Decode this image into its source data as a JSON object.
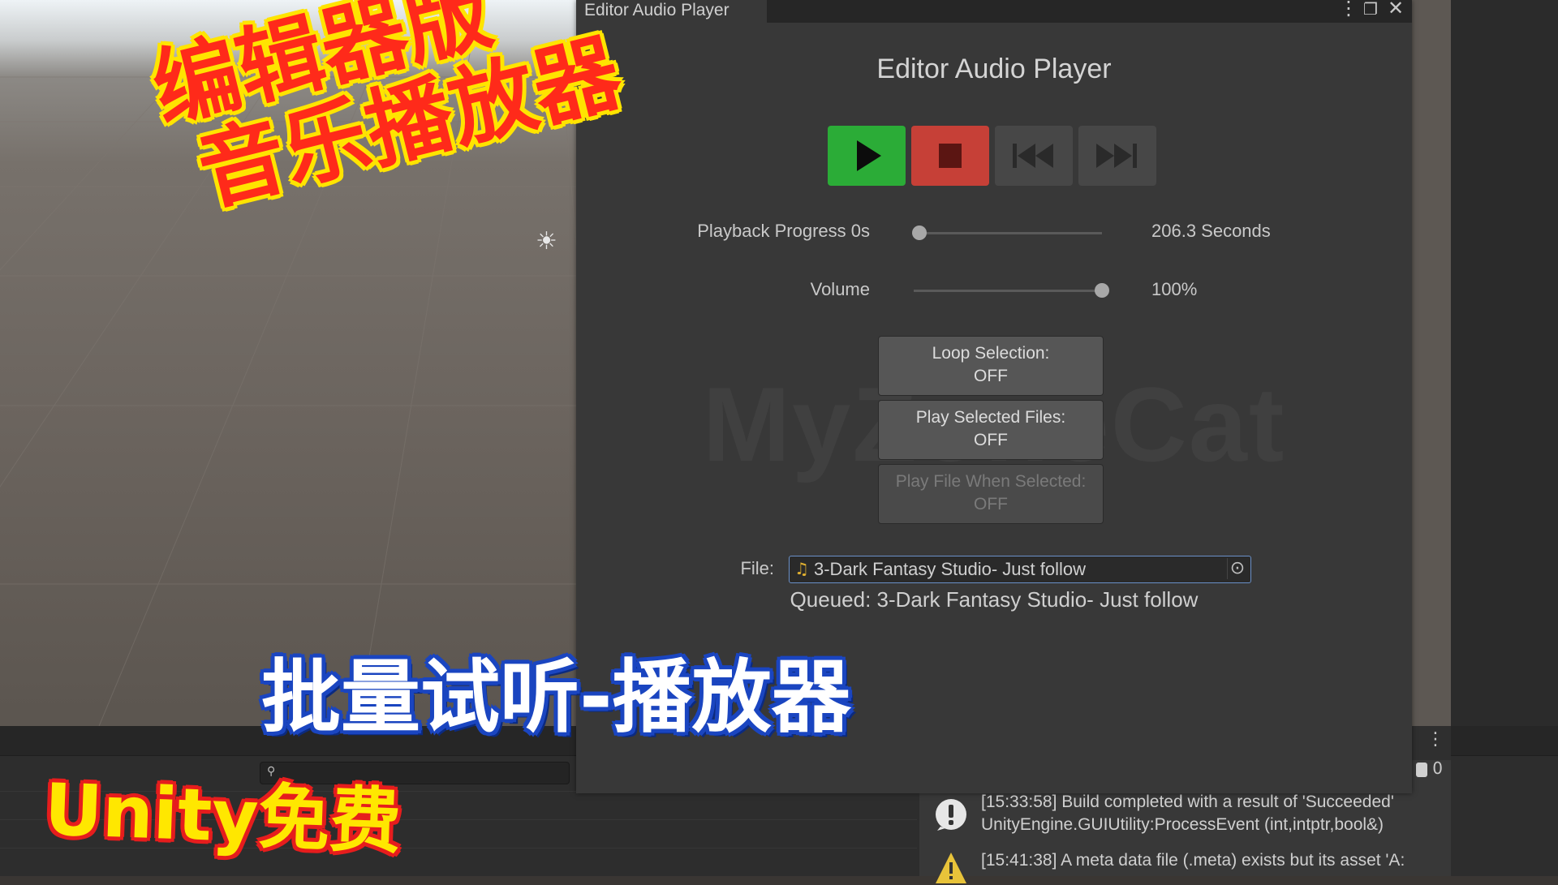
{
  "window": {
    "tab_title": "Editor Audio Player",
    "title": "Editor Audio Player",
    "watermark": "MyZoneCat"
  },
  "transport": {
    "play_icon": "play-icon",
    "stop_icon": "stop-icon",
    "prev_icon": "skip-back-icon",
    "next_icon": "skip-forward-icon",
    "colors": {
      "play": "#2bac37",
      "stop": "#c64037",
      "idle": "#474747"
    }
  },
  "playback": {
    "label": "Playback Progress 0s",
    "value_text": "206.3 Seconds",
    "progress": 0
  },
  "volume": {
    "label": "Volume",
    "value_text": "100%",
    "level": 1.0
  },
  "toggles": [
    {
      "line1": "Loop Selection:",
      "line2": "OFF"
    },
    {
      "line1": "Play Selected Files:",
      "line2": "OFF"
    },
    {
      "line1": "Play File When Selected:",
      "line2": "OFF"
    }
  ],
  "file": {
    "label": "File:",
    "value": "3-Dark Fantasy Studio- Just follow"
  },
  "queued": "Queued: 3-Dark Fantasy Studio- Just follow",
  "console": {
    "count": "0",
    "logs": [
      {
        "line1": "[15:33:58] Build completed with a result of 'Succeeded'",
        "line2": "UnityEngine.GUIUtility:ProcessEvent (int,intptr,bool&)"
      },
      {
        "line1": "[15:41:38] A meta data file (.meta) exists but its asset 'A:"
      }
    ]
  },
  "captions": {
    "editor_line1": "编辑器版",
    "editor_line2": "音乐播放器",
    "batch": "批量试听-播放器",
    "unity": "Unity免费"
  }
}
